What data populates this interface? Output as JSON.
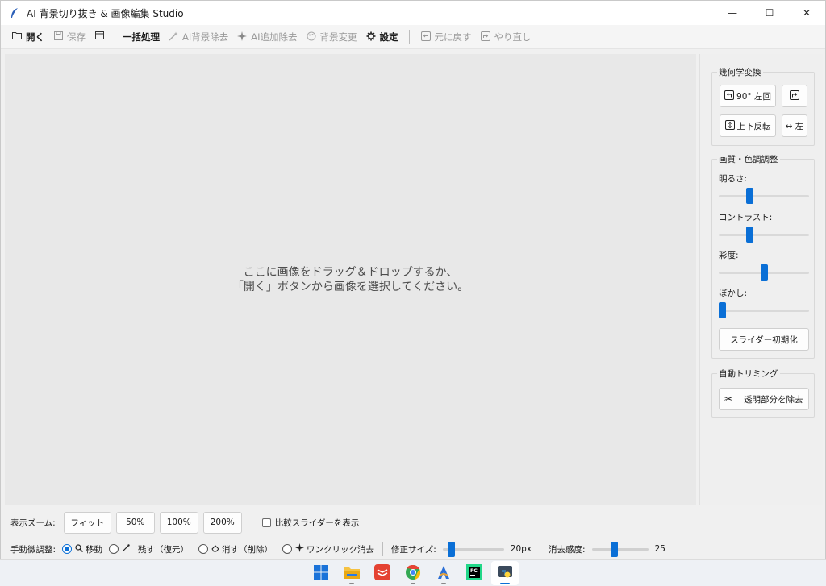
{
  "window": {
    "title": "AI 背景切り抜き & 画像編集 Studio",
    "minimize_glyph": "—",
    "maximize_glyph": "☐",
    "close_glyph": "✕"
  },
  "toolbar": {
    "open": "開く",
    "save": "保存",
    "batch": "一括処理",
    "ai_remove_bg": "AI背景除去",
    "ai_extra_remove": "AI追加除去",
    "change_bg": "背景変更",
    "settings": "設定",
    "undo": "元に戻す",
    "redo": "やり直し"
  },
  "canvas": {
    "hint_line1": "ここに画像をドラッグ＆ドロップするか、",
    "hint_line2": "「開く」ボタンから画像を選択してください。"
  },
  "right_panel": {
    "geometry": {
      "title": "幾何学変換",
      "rotate_left": "90° 左回",
      "flip_vertical": "上下反転",
      "flip_h_partial": "↔ 左"
    },
    "color": {
      "title": "画質・色調調整",
      "brightness": "明るさ:",
      "contrast": "コントラスト:",
      "saturation": "彩度:",
      "blur": "ぼかし:",
      "reset": "スライダー初期化",
      "brightness_level": 0.33,
      "contrast_level": 0.33,
      "saturation_level": 0.5,
      "blur_level": 0.0
    },
    "autotrim": {
      "title": "自動トリミング",
      "trim_button": "透明部分を除去"
    }
  },
  "bottom": {
    "zoom_label": "表示ズーム:",
    "fit": "フィット",
    "z50": "50%",
    "z100": "100%",
    "z200": "200%",
    "compare_slider": "比較スライダーを表示",
    "adjust_label": "手動微調整:",
    "mode_move": "移動",
    "mode_keep": "残す（復元）",
    "mode_erase": "消す（削除）",
    "mode_oneclick": "ワンクリック消去",
    "brush_size_label": "修正サイズ:",
    "brush_size_value": "20px",
    "brush_size_level": 0.1,
    "sensitivity_label": "消去感度:",
    "sensitivity_value": "25",
    "sensitivity_level": 0.38
  },
  "colors": {
    "accent": "#0a6fd6",
    "canvas_bg": "#e8e8e8",
    "window_bg": "#f0f0f0"
  }
}
